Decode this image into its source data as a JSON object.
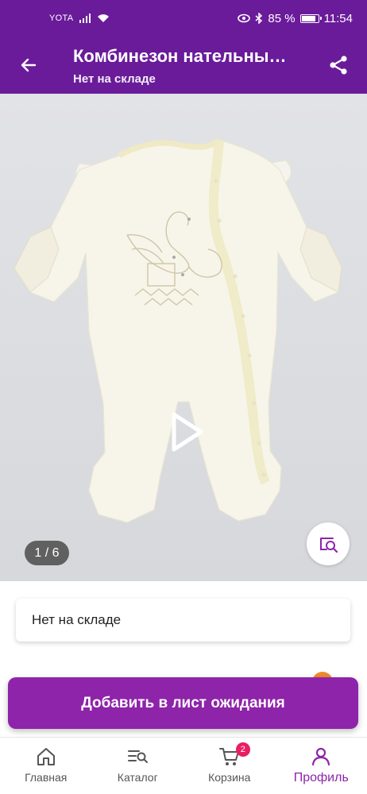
{
  "status_bar": {
    "carrier": "YOTA",
    "battery_percent": "85 %",
    "battery_level": 0.85,
    "time": "11:54"
  },
  "app_bar": {
    "title": "Комбинезон нательный для новорожденных",
    "subtitle": "Нет на складе",
    "back_icon": "arrow-left-icon",
    "share_icon": "share-icon"
  },
  "gallery": {
    "counter": "1 / 6",
    "play_icon": "play-icon",
    "search_icon": "image-search-icon"
  },
  "stock": {
    "text": "Нет на складе"
  },
  "waitlist_button": {
    "label": "Добавить в лист ожидания"
  },
  "bottom_nav": {
    "items": [
      {
        "label": "Главная",
        "icon": "home-icon"
      },
      {
        "label": "Каталог",
        "icon": "catalog-icon"
      },
      {
        "label": "Корзина",
        "icon": "cart-icon",
        "badge": "2"
      },
      {
        "label": "Профиль",
        "icon": "profile-icon",
        "active": true
      }
    ]
  },
  "colors": {
    "brand": "#6a1b9a",
    "accent": "#8e24aa",
    "badge": "#e91e63"
  }
}
